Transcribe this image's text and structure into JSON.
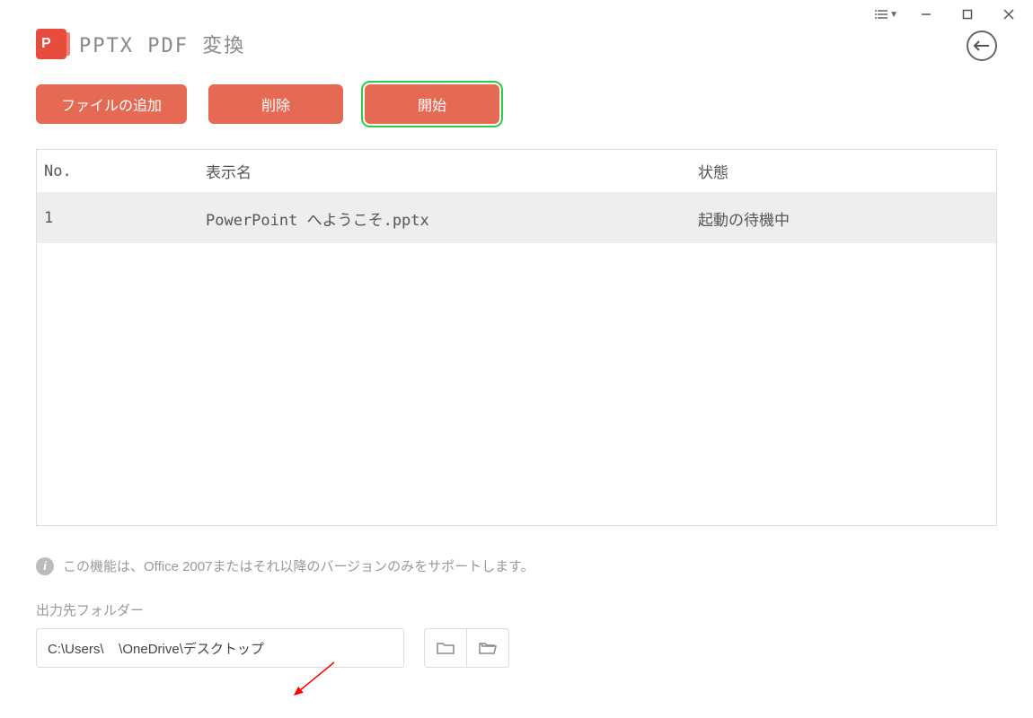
{
  "header": {
    "title": "PPTX PDF 変換"
  },
  "toolbar": {
    "add_file_label": "ファイルの追加",
    "delete_label": "削除",
    "start_label": "開始"
  },
  "table": {
    "columns": {
      "no": "No.",
      "name": "表示名",
      "status": "状態"
    },
    "rows": [
      {
        "no": "1",
        "name": "PowerPoint へようこそ.pptx",
        "status": "起動の待機中"
      }
    ]
  },
  "hint": {
    "text": "この機能は、Office 2007またはそれ以降のバージョンのみをサポートします。"
  },
  "output": {
    "label": "出力先フォルダー",
    "path": "C:\\Users\\    \\OneDrive\\デスクトップ"
  }
}
